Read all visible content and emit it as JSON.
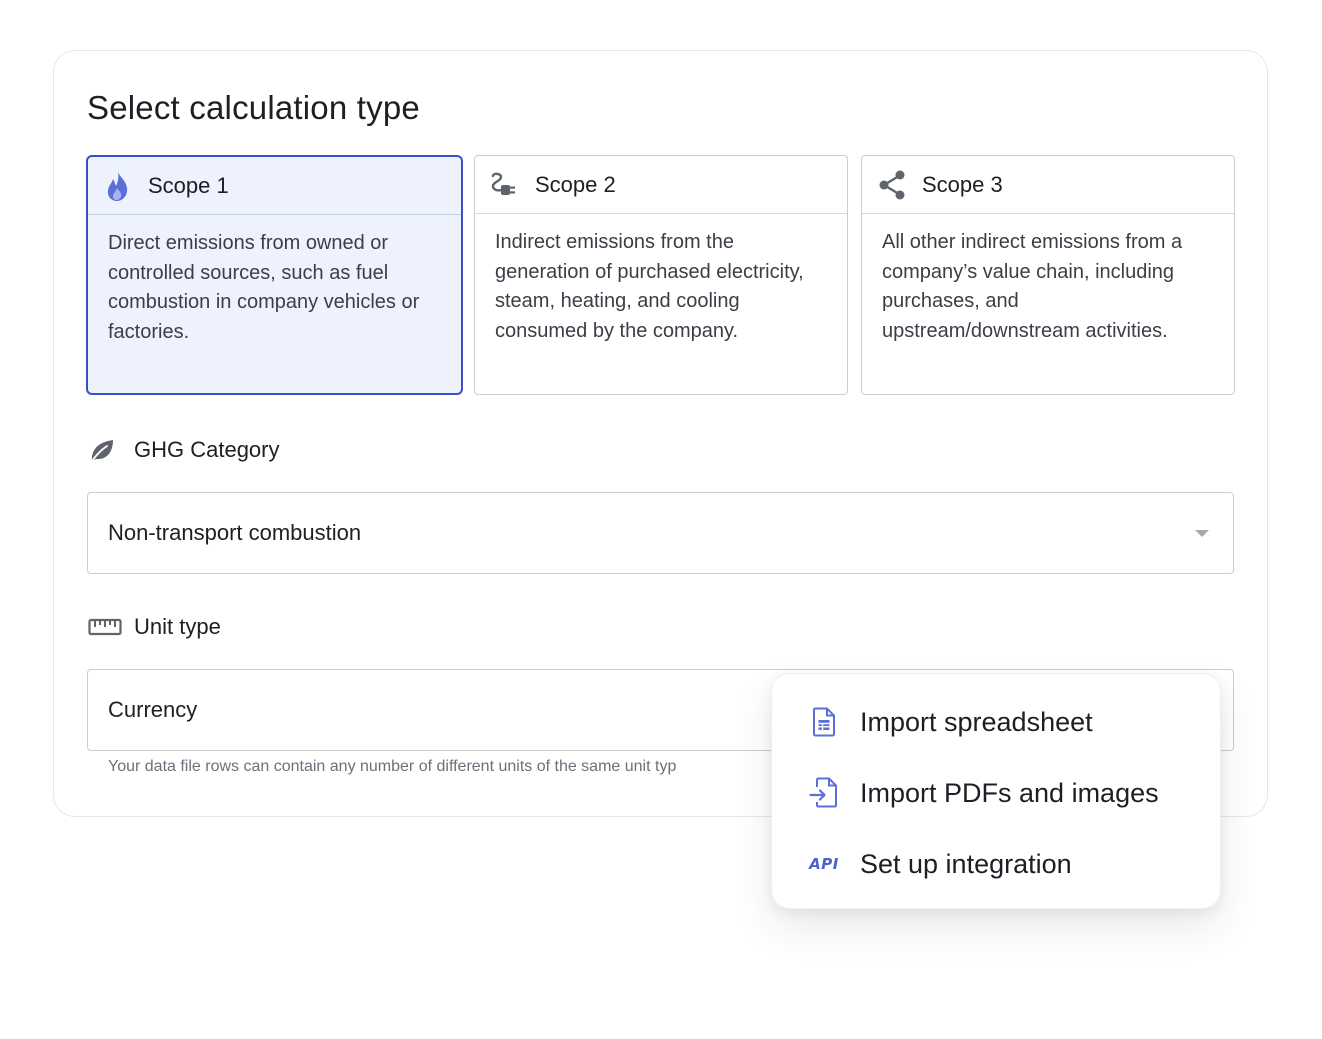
{
  "page": {
    "title": "Select calculation type"
  },
  "scopes": [
    {
      "label": "Scope 1",
      "icon": "flame-icon",
      "description": "Direct emissions from owned or controlled sources, such as fuel combustion in company vehicles or factories.",
      "selected": true
    },
    {
      "label": "Scope 2",
      "icon": "plug-icon",
      "description": "Indirect emissions from the generation of purchased electricity, steam, heating, and cooling consumed by the company.",
      "selected": false
    },
    {
      "label": "Scope 3",
      "icon": "share-icon",
      "description": "All other indirect emissions from a company’s value chain, including purchases, and upstream/downstream activities.",
      "selected": false
    }
  ],
  "ghg_category": {
    "label": "GHG Category",
    "icon": "leaf-icon",
    "value": "Non-transport combustion"
  },
  "unit_type": {
    "label": "Unit type",
    "icon": "ruler-icon",
    "value": "Currency",
    "helper": "Your data file rows can contain any number of different units of the same unit typ"
  },
  "import_menu": {
    "items": [
      {
        "label": "Import spreadsheet",
        "icon": "spreadsheet-icon"
      },
      {
        "label": "Import PDFs and images",
        "icon": "file-import-icon"
      },
      {
        "label": "Set up integration",
        "icon": "api-icon",
        "icon_text": "API"
      }
    ]
  },
  "colors": {
    "accent": "#3b4fc4",
    "selected_bg": "#eef2fd",
    "icon_blue": "#5a6fd8",
    "icon_gray": "#5f646c"
  }
}
